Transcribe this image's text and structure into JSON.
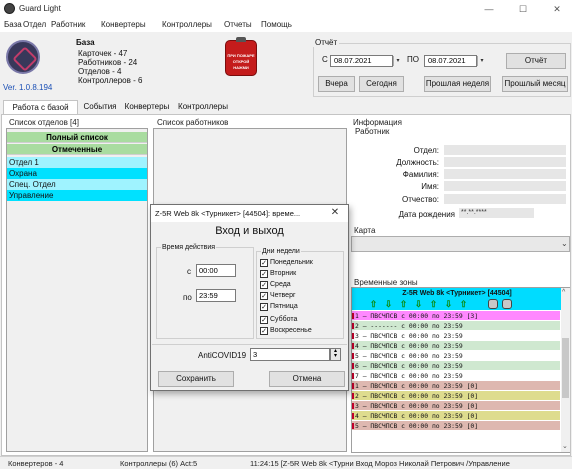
{
  "window": {
    "title": "Guard Light",
    "minimize": "—",
    "maximize": "☐",
    "close": "✕"
  },
  "menu": [
    "База",
    "Отдел",
    "Работник",
    "Конвертеры",
    "Контроллеры",
    "Отчеты",
    "Помощь"
  ],
  "app": {
    "version": "Ver. 1.0.8.194"
  },
  "db_stats": {
    "title": "База",
    "cards": "Карточек - 47",
    "workers": "Работников - 24",
    "departments": "Отделов - 4",
    "controllers": "Контроллеров - 6"
  },
  "device_label": {
    "line1": "ПРИ ПОЖАРЕ",
    "line2": "ОТКРОЙ",
    "line3": "НАЖМИ"
  },
  "report": {
    "group_title": "Отчёт",
    "from_label": "С",
    "from_date": "08.07.2021",
    "to_label": "ПО",
    "to_date": "08.07.2021",
    "report_btn": "Отчёт",
    "yesterday_btn": "Вчера",
    "today_btn": "Сегодня",
    "last_week_btn": "Прошлая неделя",
    "last_month_btn": "Прошлый месяц"
  },
  "tabs": [
    "Работа с базой",
    "События",
    "Конвертеры",
    "Контроллеры"
  ],
  "departments": {
    "caption": "Список отделов [4]",
    "full_list": "Полный список",
    "marked": "Отмеченные",
    "items": [
      "Отдел 1",
      "Охрана",
      "Спец. Отдел",
      "Управление"
    ]
  },
  "workers": {
    "caption": "Список работников"
  },
  "info": {
    "caption": "Информация",
    "worker_caption": "Работник",
    "fields": [
      {
        "label": "Отдел:",
        "value": ""
      },
      {
        "label": "Должность:",
        "value": ""
      },
      {
        "label": "Фамилия:",
        "value": ""
      },
      {
        "label": "Имя:",
        "value": ""
      },
      {
        "label": "Отчество:",
        "value": ""
      },
      {
        "label": "Дата рождения",
        "value": "**.**.****"
      }
    ]
  },
  "map": {
    "caption": "Карта"
  },
  "timezones": {
    "caption": "Временные зоны",
    "header": "Z-5R Web 8k <Турникет> [44504]",
    "rows": [
      {
        "text": "1 – ПВСЧПСВ с 00:00 по 23:59 [3]",
        "color": "#ff88ff"
      },
      {
        "text": "2 – ------- с 00:00 по 23:59",
        "color": "#cfe8d0"
      },
      {
        "text": "3 – ПВСЧПСВ с 00:00 по 23:59",
        "color": "#ffffff"
      },
      {
        "text": "4 – ПВСЧПСВ с 00:00 по 23:59",
        "color": "#cfe8d0"
      },
      {
        "text": "5 – ПВСЧПСВ с 00:00 по 23:59",
        "color": "#ffffff"
      },
      {
        "text": "6 – ПВСЧПСВ с 00:00 по 23:59",
        "color": "#cfe8d0"
      },
      {
        "text": "7 – ПВСЧПСВ с 00:00 по 23:59",
        "color": "#ffffff"
      },
      {
        "text": "1 – ПВСЧПСВ с 00:00 по 23:59 [0]",
        "color": "#deb8b0"
      },
      {
        "text": "2 – ПВСЧПСВ с 00:00 по 23:59 [0]",
        "color": "#dedc8e"
      },
      {
        "text": "3 – ПВСЧПСВ с 00:00 по 23:59 [0]",
        "color": "#deb8b0"
      },
      {
        "text": "4 – ПВСЧПСВ с 00:00 по 23:59 [0]",
        "color": "#dedc8e"
      },
      {
        "text": "5 – ПВСЧПСВ с 00:00 по 23:59 [0]",
        "color": "#deb8b0"
      }
    ]
  },
  "status": {
    "converters": "Конвертеров - 4",
    "controllers": "Контроллеры (6) Act:5",
    "event": "11:24:15 [Z-5R Web 8k <Турни Вход Мороз Николай Петрович /Управление"
  },
  "modal": {
    "title": "Z-5R Web 8k <Турникет> [44504]: време...",
    "close": "✕",
    "heading": "Вход и выход",
    "action_time": "Время действия",
    "from_label": "с",
    "from_value": "00:00",
    "to_label": "по",
    "to_value": "23:59",
    "weekdays_title": "Дни недели",
    "weekdays": [
      {
        "label": "Понедельник",
        "checked": true
      },
      {
        "label": "Вторник",
        "checked": true
      },
      {
        "label": "Среда",
        "checked": true
      },
      {
        "label": "Четверг",
        "checked": true
      },
      {
        "label": "Пятница",
        "checked": true
      },
      {
        "label": "Суббота",
        "checked": true
      },
      {
        "label": "Воскресенье",
        "checked": true
      }
    ],
    "anticovid_label": "AntiCOVID19",
    "anticovid_value": "3",
    "save_btn": "Сохранить",
    "cancel_btn": "Отмена"
  }
}
